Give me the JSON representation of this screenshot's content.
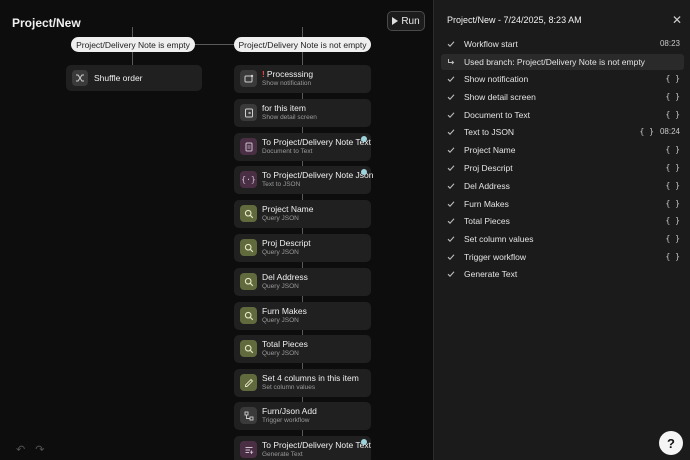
{
  "canvas": {
    "title": "Project/New",
    "run_label": "Run",
    "branch_empty": "Project/Delivery Note is empty",
    "branch_not_empty": "Project/Delivery Note is not empty",
    "left_node": {
      "title": "Shuffle order",
      "icon": "shuffle-icon"
    },
    "nodes": [
      {
        "title": "Processsing",
        "subtitle": "Show notification",
        "icon": "notification-icon",
        "color": "grey",
        "warning": "!"
      },
      {
        "title": "for this item",
        "subtitle": "Show detail screen",
        "icon": "detail-screen-icon",
        "color": "grey"
      },
      {
        "title": "To Project/Delivery Note Text",
        "subtitle": "Document to Text",
        "icon": "document-icon",
        "color": "purple"
      },
      {
        "title": "To Project/Delivery Note Json",
        "subtitle": "Text to JSON",
        "icon": "json-icon",
        "color": "purple"
      },
      {
        "title": "Project Name",
        "subtitle": "Query JSON",
        "icon": "search-icon",
        "color": "green"
      },
      {
        "title": "Proj Descript",
        "subtitle": "Query JSON",
        "icon": "search-icon",
        "color": "green"
      },
      {
        "title": "Del Address",
        "subtitle": "Query JSON",
        "icon": "search-icon",
        "color": "green"
      },
      {
        "title": "Furn Makes",
        "subtitle": "Query JSON",
        "icon": "search-icon",
        "color": "green"
      },
      {
        "title": "Total Pieces",
        "subtitle": "Query JSON",
        "icon": "search-icon",
        "color": "green"
      },
      {
        "title": "Set 4 columns in this item",
        "subtitle": "Set column values",
        "icon": "edit-columns-icon",
        "color": "green"
      },
      {
        "title": "Furn/Json Add",
        "subtitle": "Trigger workflow",
        "icon": "workflow-icon",
        "color": "grey"
      },
      {
        "title": "To Project/Delivery Note Text",
        "subtitle": "Generate Text",
        "icon": "generate-text-icon",
        "color": "purple"
      }
    ]
  },
  "panel": {
    "title": "Project/New - 7/24/2025, 8:23 AM",
    "steps": [
      {
        "label": "Workflow start",
        "time": "08:23"
      },
      {
        "label": "Used branch: Project/Delivery Note is not empty",
        "branch": true
      },
      {
        "label": "Show notification",
        "braces": "{ }"
      },
      {
        "label": "Show detail screen",
        "braces": "{ }"
      },
      {
        "label": "Document to Text",
        "braces": "{ }"
      },
      {
        "label": "Text to JSON",
        "braces": "{ }",
        "time": "08:24"
      },
      {
        "label": "Project Name",
        "braces": "{ }"
      },
      {
        "label": "Proj Descript",
        "braces": "{ }"
      },
      {
        "label": "Del Address",
        "braces": "{ }"
      },
      {
        "label": "Furn Makes",
        "braces": "{ }"
      },
      {
        "label": "Total Pieces",
        "braces": "{ }"
      },
      {
        "label": "Set column values",
        "braces": "{ }"
      },
      {
        "label": "Trigger workflow",
        "braces": "{ }"
      },
      {
        "label": "Generate Text"
      }
    ]
  },
  "help_label": "?"
}
